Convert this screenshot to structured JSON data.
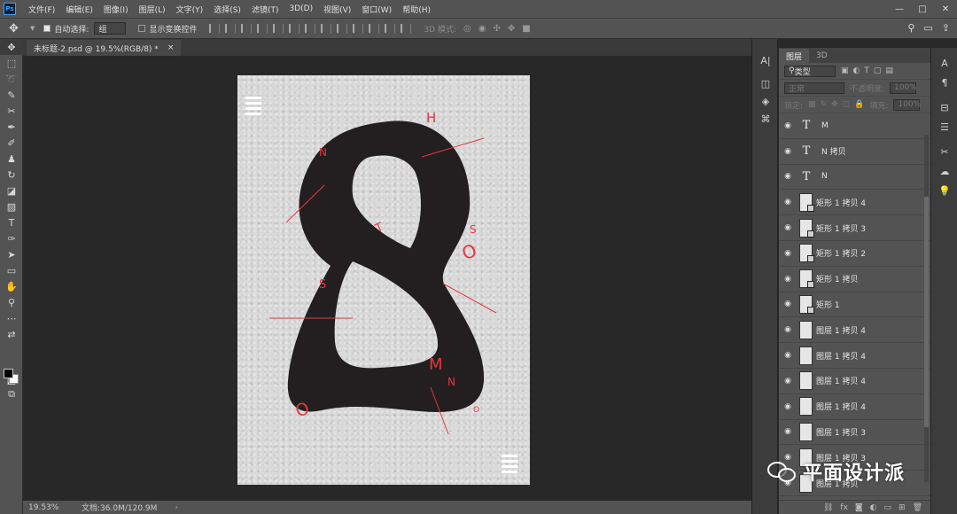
{
  "menubar": {
    "logo": "Ps",
    "items": [
      "文件(F)",
      "编辑(E)",
      "图像(I)",
      "图层(L)",
      "文字(Y)",
      "选择(S)",
      "滤镜(T)",
      "3D(D)",
      "视图(V)",
      "窗口(W)",
      "帮助(H)"
    ],
    "window_controls": [
      "—",
      "□",
      "✕"
    ]
  },
  "options": {
    "auto_select_label": "自动选择:",
    "auto_select_value": "组",
    "show_transform_label": "显示变换控件",
    "three_d_mode_label": "3D 模式:"
  },
  "document": {
    "tab_title": "未标题-2.psd @ 19.5%(RGB/8) *",
    "close": "×"
  },
  "status": {
    "zoom": "19.53%",
    "doc_info": "文档:36.0M/120.9M"
  },
  "canvas": {
    "letters": [
      "H",
      "N",
      "T",
      "S",
      "O",
      "S",
      "M",
      "N",
      "O",
      "O"
    ],
    "ink_color": "#231f20",
    "accent_color": "#e8373c"
  },
  "layers_panel": {
    "tabs": [
      "图层",
      "3D"
    ],
    "filter_label": "类型",
    "blend_mode": "正常",
    "opacity_label": "不透明度:",
    "opacity_value": "100%",
    "lock_label": "锁定:",
    "fill_label": "填充:",
    "fill_value": "100%",
    "layers": [
      {
        "type": "text",
        "name": "M"
      },
      {
        "type": "text",
        "name": "N 拷贝"
      },
      {
        "type": "text",
        "name": "N"
      },
      {
        "type": "shape",
        "name": "矩形 1 拷贝 4"
      },
      {
        "type": "shape",
        "name": "矩形 1 拷贝 3"
      },
      {
        "type": "shape",
        "name": "矩形 1 拷贝 2"
      },
      {
        "type": "shape",
        "name": "矩形 1 拷贝"
      },
      {
        "type": "shape",
        "name": "矩形 1"
      },
      {
        "type": "pixel",
        "name": "图层 1 拷贝 4"
      },
      {
        "type": "pixel",
        "name": "图层 1 拷贝 4"
      },
      {
        "type": "pixel",
        "name": "图层 1 拷贝 4"
      },
      {
        "type": "pixel",
        "name": "图层 1 拷贝 4"
      },
      {
        "type": "pixel",
        "name": "图层 1 拷贝 3"
      },
      {
        "type": "pixel",
        "name": "图层 1 拷贝 3"
      },
      {
        "type": "pixel",
        "name": "图层 1 拷贝"
      }
    ]
  },
  "watermark": {
    "text": "平面设计派"
  }
}
